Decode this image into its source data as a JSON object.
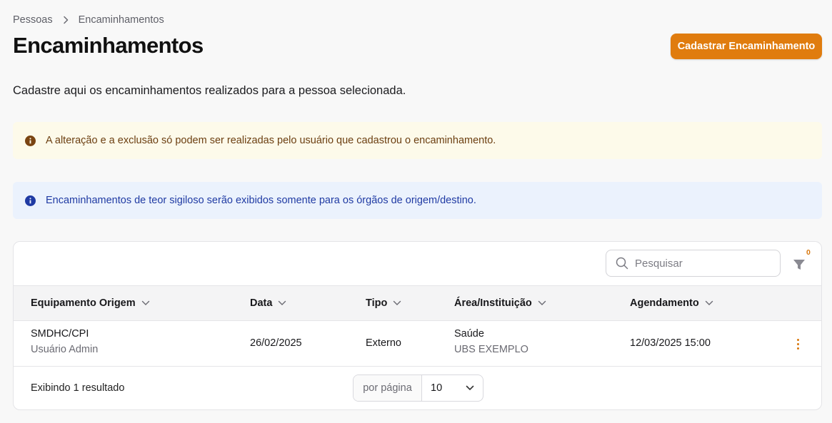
{
  "breadcrumb": {
    "items": [
      "Pessoas",
      "Encaminhamentos"
    ]
  },
  "header": {
    "title": "Encaminhamentos",
    "action_label": "Cadastrar Encaminhamento"
  },
  "subtitle": "Cadastre aqui os encaminhamentos realizados para a pessoa selecionada.",
  "alerts": {
    "warning": "A alteração e a exclusão só podem ser realizadas pelo usuário que cadastrou o encaminhamento.",
    "info": "Encaminhamentos de teor sigiloso serão exibidos somente para os órgãos de origem/destino."
  },
  "toolbar": {
    "search_placeholder": "Pesquisar",
    "filter_count": "0"
  },
  "table": {
    "columns": [
      "Equipamento Origem",
      "Data",
      "Tipo",
      "Área/Instituição",
      "Agendamento"
    ],
    "rows": [
      {
        "equipamento": "SMDHC/CPI",
        "usuario": "Usuário Admin",
        "data": "26/02/2025",
        "tipo": "Externo",
        "area": "Saúde",
        "instituicao": "UBS EXEMPLO",
        "agendamento": "12/03/2025 15:00"
      }
    ]
  },
  "footer": {
    "result_text": "Exibindo 1 resultado",
    "per_page_label": "por página",
    "per_page_value": "10"
  },
  "colors": {
    "accent": "#e07c0e",
    "warning_bg": "#fdfaea",
    "warning_fg": "#6b3e10",
    "info_bg": "#ebf2fd",
    "info_fg": "#1f3aa3"
  },
  "icons": [
    "chevron-right-icon",
    "info-icon",
    "search-icon",
    "filter-icon",
    "chevron-down-icon",
    "more-vertical-icon"
  ]
}
